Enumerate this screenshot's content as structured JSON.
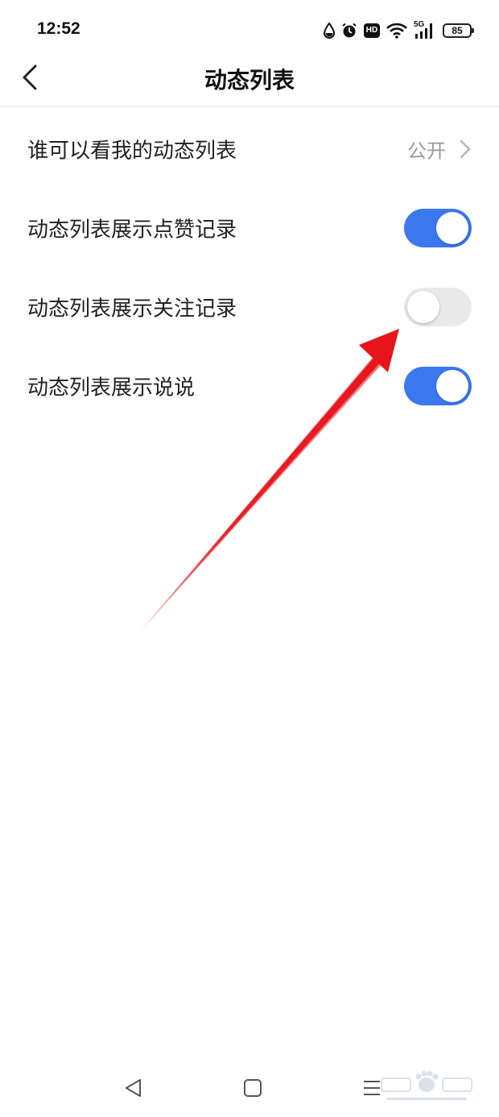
{
  "status_bar": {
    "time": "12:52",
    "network": "5G",
    "hd_label": "HD",
    "battery": "85",
    "icons": [
      "water-drop-icon",
      "alarm-icon",
      "hd-icon",
      "wifi-icon",
      "signal-icon",
      "battery-icon"
    ]
  },
  "header": {
    "title": "动态列表",
    "back_icon": "chevron-left-icon"
  },
  "settings": [
    {
      "label": "谁可以看我的动态列表",
      "type": "link",
      "value": "公开"
    },
    {
      "label": "动态列表展示点赞记录",
      "type": "toggle",
      "checked": true
    },
    {
      "label": "动态列表展示关注记录",
      "type": "toggle",
      "checked": false
    },
    {
      "label": "动态列表展示说说",
      "type": "toggle",
      "checked": true
    }
  ],
  "colors": {
    "toggle_on": "#3b78f0",
    "toggle_off": "#e9e9e9",
    "annotation_arrow": "#e8141c"
  },
  "nav_bar": {
    "icons": [
      "triangle-back-icon",
      "square-home-icon",
      "menu-lines-icon"
    ]
  }
}
